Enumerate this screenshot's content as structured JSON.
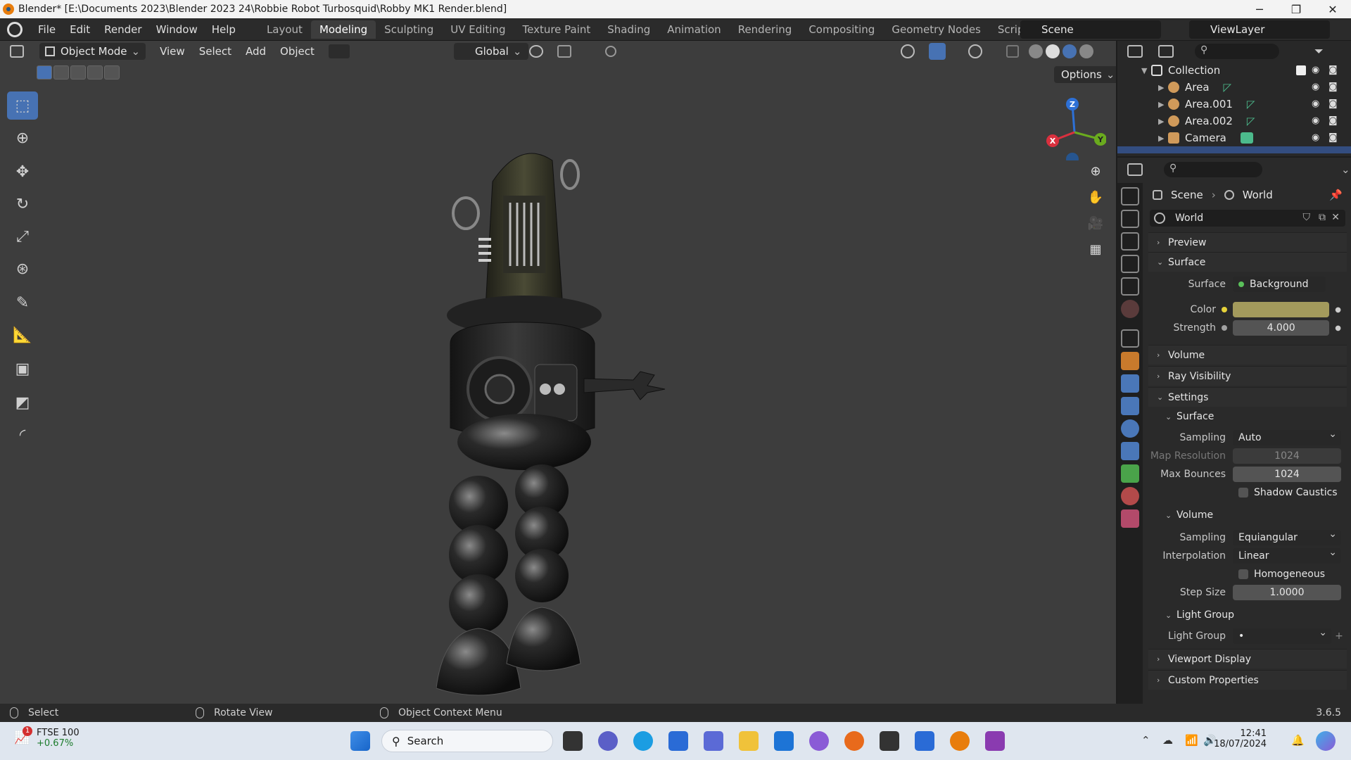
{
  "window": {
    "title": "Blender* [E:\\Documents 2023\\Blender 2023 24\\Robbie Robot Turbosquid\\Robby MK1 Render.blend]",
    "minimize": "─",
    "maximize": "❐",
    "close": "✕"
  },
  "menu": [
    "File",
    "Edit",
    "Render",
    "Window",
    "Help"
  ],
  "workspaces": [
    {
      "label": "Layout",
      "active": false
    },
    {
      "label": "Modeling",
      "active": true
    },
    {
      "label": "Sculpting",
      "active": false
    },
    {
      "label": "UV Editing",
      "active": false
    },
    {
      "label": "Texture Paint",
      "active": false
    },
    {
      "label": "Shading",
      "active": false
    },
    {
      "label": "Animation",
      "active": false
    },
    {
      "label": "Rendering",
      "active": false
    },
    {
      "label": "Compositing",
      "active": false
    },
    {
      "label": "Geometry Nodes",
      "active": false
    },
    {
      "label": "Scripting",
      "active": false
    }
  ],
  "workspace_add": "+",
  "scene_name": "Scene",
  "view_layer": "ViewLayer",
  "viewport": {
    "mode": "Object Mode",
    "menus": [
      "View",
      "Select",
      "Add",
      "Object"
    ],
    "transform_orientation": "Global",
    "options_label": "Options",
    "gizmo": {
      "x": "X",
      "y": "Y",
      "z": "Z"
    }
  },
  "outliner": {
    "collection": "Collection",
    "items": [
      "Area",
      "Area.001",
      "Area.002",
      "Camera"
    ]
  },
  "properties": {
    "breadcrumb": [
      "Scene",
      "World"
    ],
    "world_name": "World",
    "panels": {
      "preview": "Preview",
      "surface": "Surface",
      "volume": "Volume",
      "ray_visibility": "Ray Visibility",
      "settings": "Settings",
      "viewport_display": "Viewport Display",
      "custom_properties": "Custom Properties"
    },
    "surface": {
      "surface_label": "Surface",
      "surface_value": "Background",
      "color_label": "Color",
      "color_value": "#a39a5c",
      "strength_label": "Strength",
      "strength_value": "4.000"
    },
    "settings_surface": {
      "header": "Surface",
      "sampling_label": "Sampling",
      "sampling_value": "Auto",
      "map_res_label": "Map Resolution",
      "map_res_value": "1024",
      "max_bounces_label": "Max Bounces",
      "max_bounces_value": "1024",
      "shadow_caustics": "Shadow Caustics"
    },
    "settings_volume": {
      "header": "Volume",
      "sampling_label": "Sampling",
      "sampling_value": "Equiangular",
      "interp_label": "Interpolation",
      "interp_value": "Linear",
      "homogeneous": "Homogeneous",
      "step_label": "Step Size",
      "step_value": "1.0000"
    },
    "light_group": {
      "header": "Light Group",
      "label": "Light Group",
      "value": "•"
    }
  },
  "status": {
    "select": "Select",
    "rotate": "Rotate View",
    "context": "Object Context Menu",
    "version": "3.6.5"
  },
  "taskbar": {
    "widget_title": "FTSE 100",
    "widget_value": "+0.67%",
    "widget_badge": "1",
    "search_placeholder": "Search",
    "time": "12:41",
    "date": "18/07/2024"
  }
}
